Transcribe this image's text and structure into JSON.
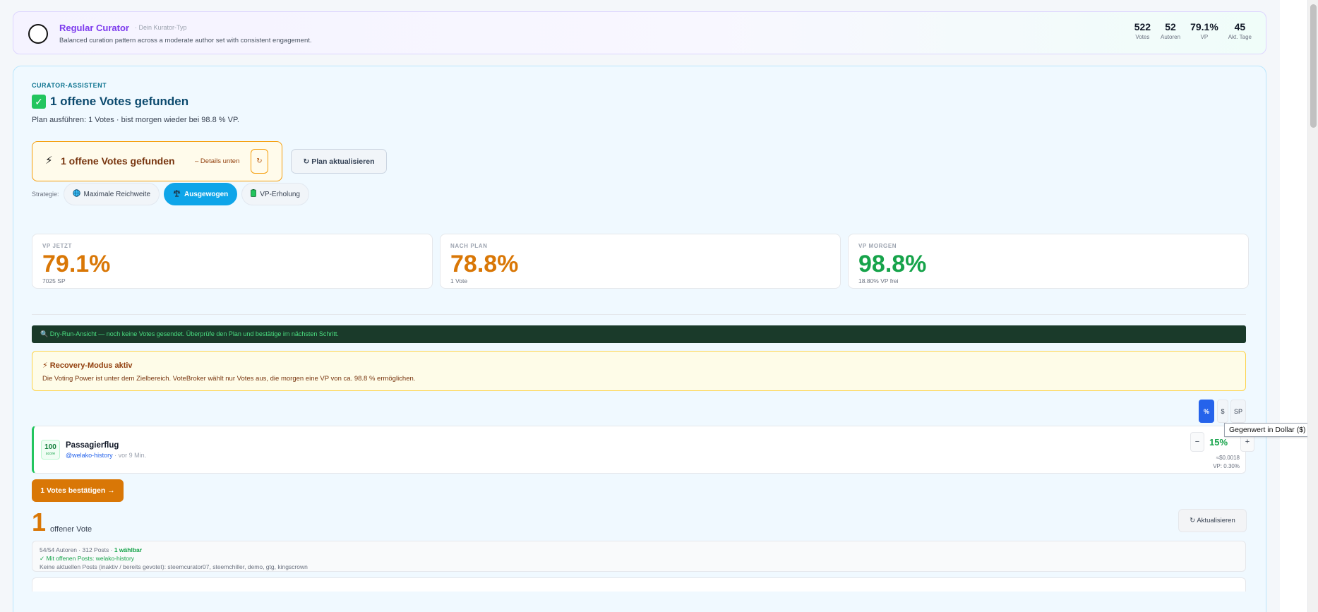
{
  "header": {
    "title": "Regular Curator",
    "subtitle": "· Dein Kurator-Typ",
    "description": "Balanced curation pattern across a moderate author set with consistent engagement.",
    "stats": [
      {
        "value": "522",
        "label": "Votes"
      },
      {
        "value": "52",
        "label": "Autoren"
      },
      {
        "value": "79.1%",
        "label": "VP"
      },
      {
        "value": "45",
        "label": "Akt. Tage"
      }
    ]
  },
  "assistant": {
    "kicker": "CURATOR-ASSISTENT",
    "check_icon": "✓",
    "heading": "1 offene Votes gefunden",
    "plan_line": "Plan ausführen: 1 Votes · bist morgen wieder bei 98.8 % VP.",
    "alert": {
      "icon": "⚡",
      "title": "1 offene Votes gefunden",
      "detail": "– Details unten",
      "refresh_icon": "↻"
    },
    "plan_button": "↻ Plan aktualisieren",
    "strategy": {
      "label": "Strategie:",
      "options": [
        {
          "icon": "globe-icon",
          "label": "Maximale Reichweite",
          "active": false
        },
        {
          "icon": "balance-icon",
          "label": "Ausgewogen",
          "active": true
        },
        {
          "icon": "battery-icon",
          "label": "VP-Erholung",
          "active": false
        }
      ]
    },
    "cards": [
      {
        "key": "VP JETZT",
        "value": "79.1%",
        "sub": "7025 SP",
        "color": "#d97706"
      },
      {
        "key": "NACH PLAN",
        "value": "78.8%",
        "sub": "1 Vote",
        "color": "#d97706"
      },
      {
        "key": "VP MORGEN",
        "value": "98.8%",
        "sub": "18.80% VP frei",
        "color": "#16a34a"
      }
    ],
    "dry_run": "🔍  Dry-Run-Ansicht — noch keine Votes gesendet. Überprüfe den Plan und bestätige im nächsten Schritt.",
    "recovery": {
      "title": "⚡ Recovery-Modus aktiv",
      "text": "Die Voting Power ist unter dem Zielbereich. VoteBroker wählt nur Votes aus, die morgen eine VP von ca. 98.8 % ermöglichen."
    },
    "units": [
      "%",
      "$",
      "SP"
    ],
    "tooltip": "Gegenwert in Dollar ($)",
    "vote": {
      "score": "100",
      "score_label": "score",
      "title": "Passagierflug",
      "author": "@welako-history",
      "time": "· vor 9 Min.",
      "minus": "−",
      "percent": "15%",
      "plus": "+",
      "usd": "≈$0.0018",
      "vp": "VP: 0.30%"
    },
    "confirm_button": "1 Votes bestätigen →",
    "open_count": "1",
    "open_label": "offener Vote",
    "refresh_button": "↻ Aktualisieren",
    "summary": {
      "line1_prefix": "54/54 Autoren · 312 Posts · ",
      "line1_ok": "1 wählbar",
      "line2": "✓ Mit offenen Posts: welako-history",
      "line3": "Keine aktuellen Posts (inaktiv / bereits gevotet): steemcurator07, steemchiller, demo, gtg, kingscrown"
    }
  }
}
